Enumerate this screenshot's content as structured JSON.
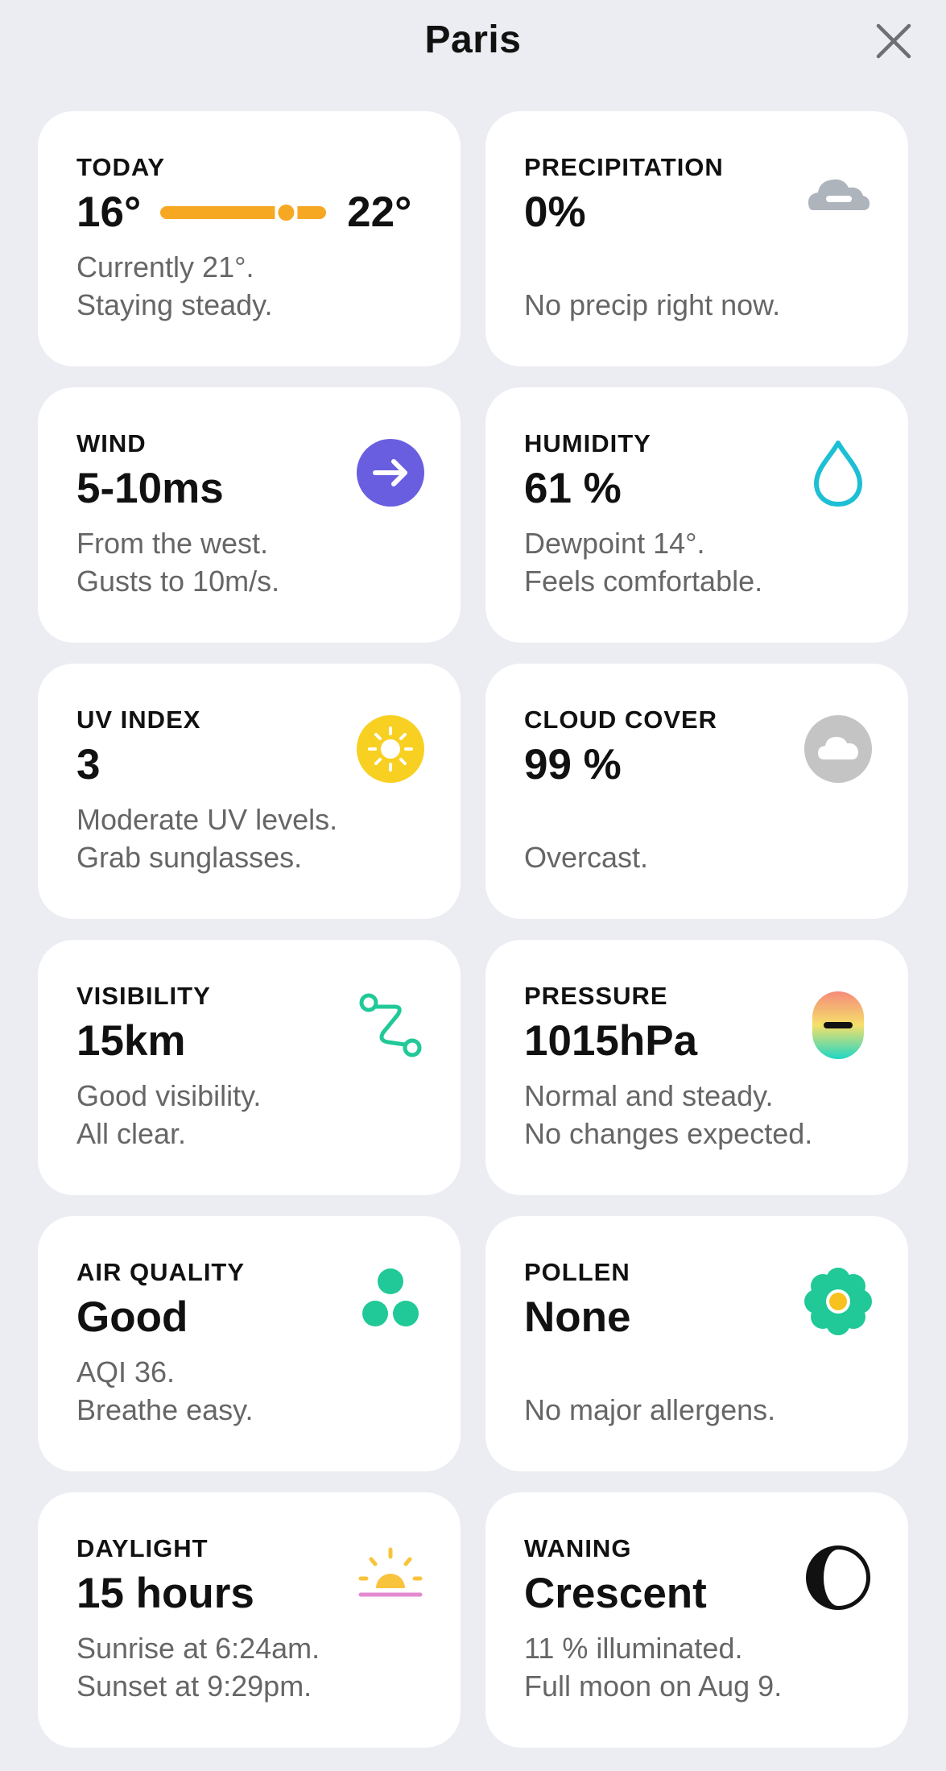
{
  "header": {
    "title": "Paris"
  },
  "today": {
    "label": "TODAY",
    "low": "16°",
    "high": "22°",
    "line1": "Currently 21°.",
    "line2": "Staying steady.",
    "current_position_fraction": 0.83
  },
  "precipitation": {
    "label": "PRECIPITATION",
    "value": "0%",
    "line1": "",
    "line2": "No precip right now.",
    "icon": "cloud-icon"
  },
  "wind": {
    "label": "WIND",
    "value": "5-10ms",
    "line1": "From the west.",
    "line2": "Gusts to 10m/s.",
    "icon": "wind-arrow-icon"
  },
  "humidity": {
    "label": "HUMIDITY",
    "value": "61 %",
    "line1": "Dewpoint 14°.",
    "line2": "Feels comfortable.",
    "icon": "droplet-icon"
  },
  "uv": {
    "label": "UV INDEX",
    "value": "3",
    "line1": "Moderate UV levels.",
    "line2": "Grab sunglasses.",
    "icon": "sun-icon"
  },
  "cloud": {
    "label": "CLOUD COVER",
    "value": "99 %",
    "line1": "",
    "line2": "Overcast.",
    "icon": "cloud-cover-icon"
  },
  "visibility": {
    "label": "VISIBILITY",
    "value": "15km",
    "line1": "Good visibility.",
    "line2": "All clear.",
    "icon": "route-icon"
  },
  "pressure": {
    "label": "PRESSURE",
    "value": "1015hPa",
    "line1": "Normal and steady.",
    "line2": "No changes expected.",
    "icon": "pressure-gauge-icon"
  },
  "air": {
    "label": "AIR QUALITY",
    "value": "Good",
    "line1": "AQI 36.",
    "line2": "Breathe easy.",
    "icon": "air-quality-icon"
  },
  "pollen": {
    "label": "POLLEN",
    "value": "None",
    "line1": "",
    "line2": "No major allergens.",
    "icon": "flower-icon"
  },
  "daylight": {
    "label": "DAYLIGHT",
    "value": "15 hours",
    "line1": "Sunrise at 6:24am.",
    "line2": "Sunset at 9:29pm.",
    "icon": "sunrise-icon"
  },
  "moon": {
    "label": "WANING",
    "value": "Crescent",
    "line1": "11 % illuminated.",
    "line2": "Full moon on Aug 9.",
    "icon": "moon-phase-icon"
  },
  "colors": {
    "background": "#ececf3",
    "card": "#ffffff",
    "temp_bar": "#f7a823",
    "wind": "#6a5ee0",
    "humidity": "#1dbfd4",
    "uv": "#f8d022",
    "cloud_cover": "#c4c4c4",
    "green": "#20c997",
    "daylight_sun": "#f8c43e",
    "daylight_line": "#e38ad0"
  }
}
